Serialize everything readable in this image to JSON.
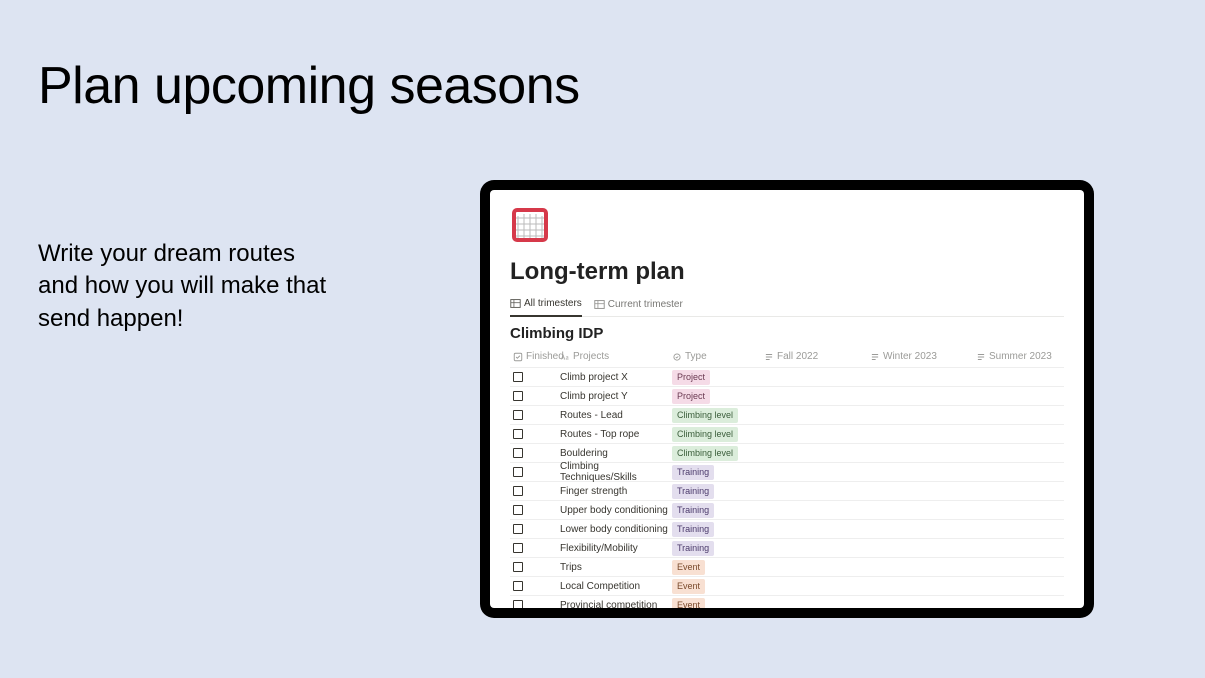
{
  "slide": {
    "title": "Plan upcoming seasons",
    "subtitle_line1": "Write your dream routes",
    "subtitle_line2": "and how you will make that",
    "subtitle_line3": "send happen!"
  },
  "notion": {
    "icon_name": "goal-net-icon",
    "page_title": "Long-term plan",
    "tabs": [
      {
        "label": "All trimesters",
        "active": true
      },
      {
        "label": "Current trimester",
        "active": false
      }
    ],
    "group_title": "Climbing IDP",
    "columns": {
      "finished": "Finished",
      "projects": "Projects",
      "type": "Type",
      "fall": "Fall 2022",
      "winter": "Winter 2023",
      "summer": "Summer 2023"
    },
    "type_colors": {
      "Project": "tag-pink",
      "Climbing level": "tag-green",
      "Training": "tag-purple",
      "Event": "tag-orange"
    },
    "rows": [
      {
        "name": "Climb project X",
        "type": "Project"
      },
      {
        "name": "Climb project Y",
        "type": "Project"
      },
      {
        "name": "Routes - Lead",
        "type": "Climbing level"
      },
      {
        "name": "Routes - Top rope",
        "type": "Climbing level"
      },
      {
        "name": "Bouldering",
        "type": "Climbing level"
      },
      {
        "name": "Climbing Techniques/Skills",
        "type": "Training"
      },
      {
        "name": "Finger strength",
        "type": "Training"
      },
      {
        "name": "Upper body conditioning",
        "type": "Training"
      },
      {
        "name": "Lower body conditioning",
        "type": "Training"
      },
      {
        "name": "Flexibility/Mobility",
        "type": "Training"
      },
      {
        "name": "Trips",
        "type": "Event"
      },
      {
        "name": "Local Competition",
        "type": "Event"
      },
      {
        "name": "Provincial competition",
        "type": "Event"
      }
    ]
  }
}
